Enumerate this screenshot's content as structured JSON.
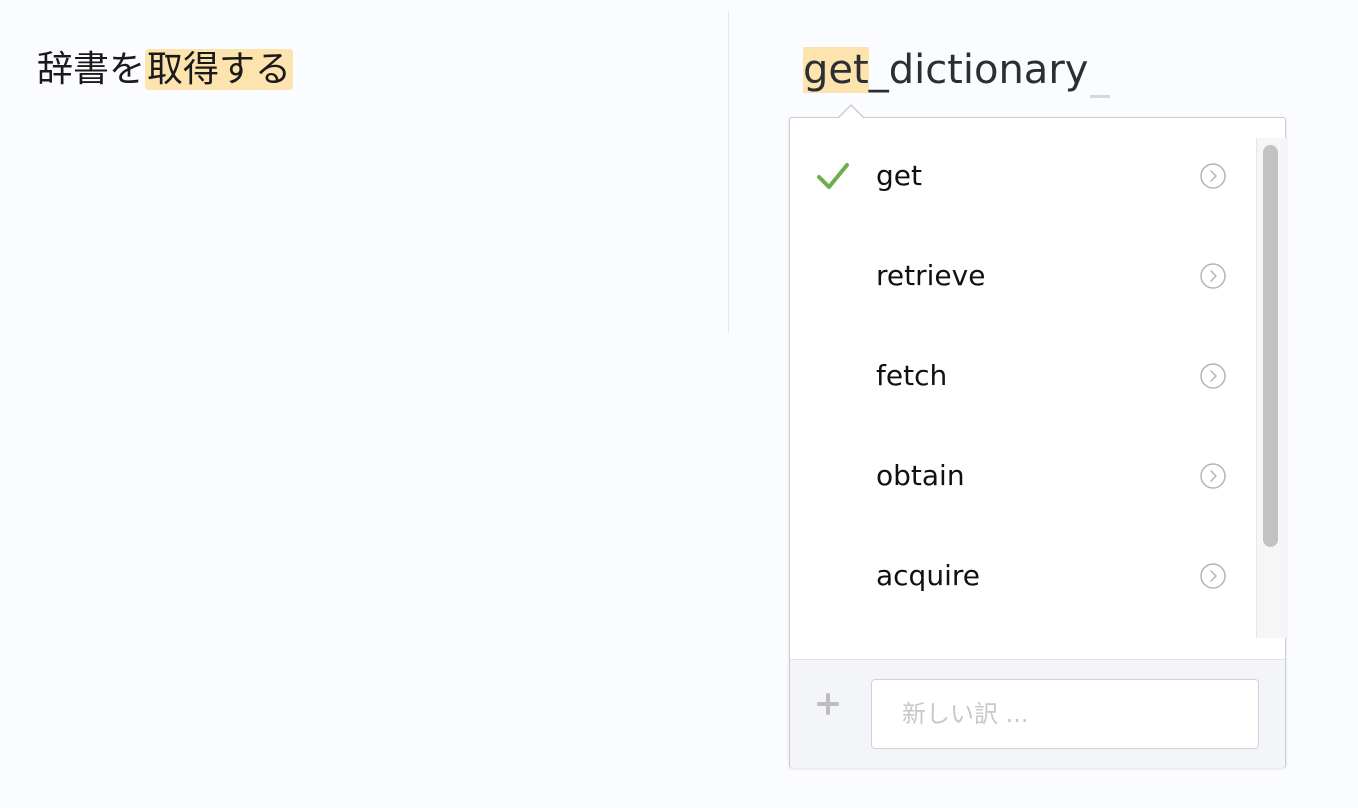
{
  "source": {
    "prefix": "辞書を",
    "highlight": "取得する"
  },
  "target": {
    "highlight": "get",
    "rest": "_dictionary"
  },
  "suggestions": {
    "items": [
      {
        "label": "get",
        "selected": true
      },
      {
        "label": "retrieve",
        "selected": false
      },
      {
        "label": "fetch",
        "selected": false
      },
      {
        "label": "obtain",
        "selected": false
      },
      {
        "label": "acquire",
        "selected": false
      }
    ]
  },
  "new_translation": {
    "placeholder": "新しい訳 ..."
  },
  "colors": {
    "highlight": "#fde3ad",
    "check": "#6ab04c",
    "icon_gray": "#b5b5b5"
  },
  "icons": {
    "selected": "check-icon",
    "item_action": "chevron-circle-right-icon",
    "add": "plus-icon"
  }
}
